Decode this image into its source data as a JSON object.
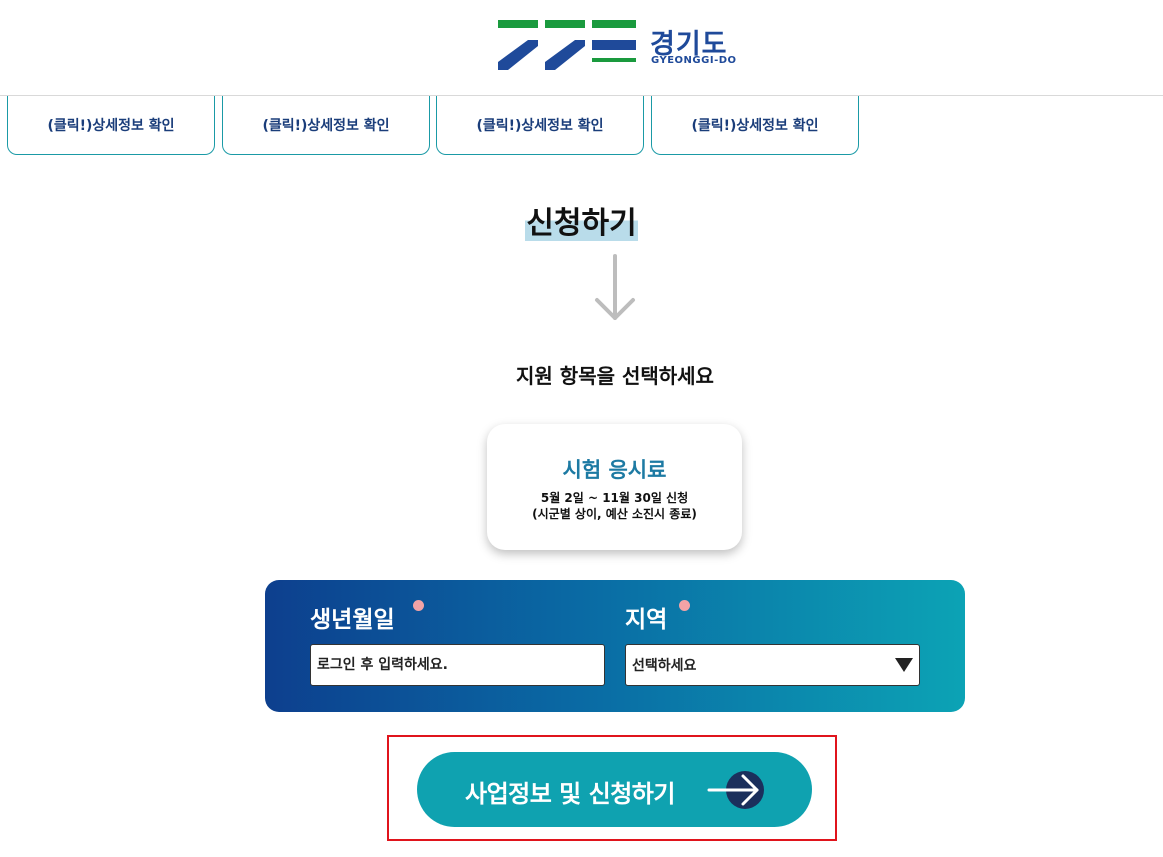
{
  "header": {
    "logo_text": "경기도",
    "logo_subtext": "GYEONGGI-DO",
    "brand_colors": {
      "green": "#1a9a3e",
      "blue": "#1f4a9a"
    }
  },
  "detail_buttons": [
    {
      "label": "(클릭!)상세정보 확인"
    },
    {
      "label": "(클릭!)상세정보 확인"
    },
    {
      "label": "(클릭!)상세정보 확인"
    },
    {
      "label": "(클릭!)상세정보 확인"
    }
  ],
  "apply": {
    "heading": "신청하기",
    "arrow_icon": "arrow-down-icon",
    "instruction": "지원 항목을 선택하세요"
  },
  "support_item": {
    "title": "시험 응시료",
    "period": "5월 2일 ~ 11월 30일 신청",
    "note": "(시군별 상이, 예산 소진시 종료)"
  },
  "form": {
    "birth_label": "생년월일",
    "birth_placeholder": "로그인 후 입력하세요.",
    "region_label": "지역",
    "region_selected": "선택하세요"
  },
  "submit": {
    "label": "사업정보 및 신청하기",
    "icon": "arrow-right-icon"
  },
  "colors": {
    "panel_start": "#0d3f8e",
    "panel_end": "#0ca3b5",
    "button": "#0fa2b0",
    "highlight": "#e0141c",
    "required_dot": "#f3a3a6"
  }
}
